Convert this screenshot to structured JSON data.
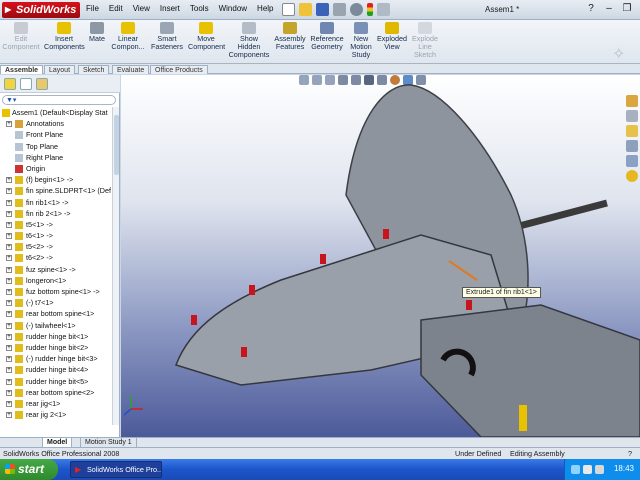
{
  "app": {
    "logo_text": "SolidWorks",
    "document_title": "Assem1 *",
    "menu": [
      "File",
      "Edit",
      "View",
      "Insert",
      "Tools",
      "Window",
      "Help"
    ]
  },
  "ribbon": {
    "buttons": [
      {
        "label_line1": "Edit",
        "label_line2": "Component",
        "enabled": false,
        "icon": "edit-component-icon"
      },
      {
        "label_line1": "Insert",
        "label_line2": "Components",
        "enabled": true,
        "icon": "insert-components-icon"
      },
      {
        "label_line1": "Mate",
        "label_line2": "",
        "enabled": true,
        "icon": "mate-icon"
      },
      {
        "label_line1": "Linear",
        "label_line2": "Compon...",
        "enabled": true,
        "icon": "linear-pattern-icon"
      },
      {
        "label_line1": "Smart",
        "label_line2": "Fasteners",
        "enabled": true,
        "icon": "smart-fasteners-icon"
      },
      {
        "label_line1": "Move",
        "label_line2": "Component",
        "enabled": true,
        "icon": "move-component-icon"
      },
      {
        "label_line1": "Show",
        "label_line2": "Hidden",
        "label_line3": "Components",
        "enabled": true,
        "icon": "show-hidden-icon"
      },
      {
        "label_line1": "Assembly",
        "label_line2": "Features",
        "enabled": true,
        "icon": "assembly-features-icon"
      },
      {
        "label_line1": "Reference",
        "label_line2": "Geometry",
        "enabled": true,
        "icon": "reference-geometry-icon"
      },
      {
        "label_line1": "New",
        "label_line2": "Motion",
        "label_line3": "Study",
        "enabled": true,
        "icon": "motion-study-icon"
      },
      {
        "label_line1": "Exploded",
        "label_line2": "View",
        "enabled": true,
        "icon": "exploded-view-icon"
      },
      {
        "label_line1": "Explode",
        "label_line2": "Line",
        "label_line3": "Sketch",
        "enabled": false,
        "icon": "explode-line-icon"
      }
    ]
  },
  "command_tabs": [
    "Assemble",
    "Layout",
    "Sketch",
    "Evaluate",
    "Office Products"
  ],
  "feature_tree": {
    "root": "Assem1  (Default<Display Stat",
    "items": [
      {
        "label": "Annotations",
        "icon": "annotations-icon",
        "expandable": true
      },
      {
        "label": "Front Plane",
        "icon": "plane-icon",
        "expandable": false
      },
      {
        "label": "Top Plane",
        "icon": "plane-icon",
        "expandable": false
      },
      {
        "label": "Right Plane",
        "icon": "plane-icon",
        "expandable": false
      },
      {
        "label": "Origin",
        "icon": "origin-icon",
        "expandable": false
      },
      {
        "label": "(f) begin<1> ->",
        "icon": "part-icon",
        "expandable": true
      },
      {
        "label": "fin spine.SLDPRT<1> (Def",
        "icon": "part-icon",
        "expandable": true
      },
      {
        "label": "fin rib1<1> ->",
        "icon": "part-icon",
        "expandable": true
      },
      {
        "label": "fin rib 2<1> ->",
        "icon": "part-icon",
        "expandable": true
      },
      {
        "label": "t5<1> ->",
        "icon": "part-icon",
        "expandable": true
      },
      {
        "label": "t6<1> ->",
        "icon": "part-icon",
        "expandable": true
      },
      {
        "label": "t5<2> ->",
        "icon": "part-icon",
        "expandable": true
      },
      {
        "label": "t6<2> ->",
        "icon": "part-icon",
        "expandable": true
      },
      {
        "label": "fuz spine<1> ->",
        "icon": "part-icon",
        "expandable": true
      },
      {
        "label": "longeron<1>",
        "icon": "part-icon",
        "expandable": true
      },
      {
        "label": "fuz bottom spine<1> ->",
        "icon": "part-icon",
        "expandable": true
      },
      {
        "label": "(-) t7<1>",
        "icon": "part-icon",
        "expandable": true
      },
      {
        "label": "rear bottom spine<1>",
        "icon": "part-icon",
        "expandable": true
      },
      {
        "label": "(-) tailwheel<1>",
        "icon": "part-icon",
        "expandable": true
      },
      {
        "label": "rudder hinge bit<1>",
        "icon": "part-icon",
        "expandable": true
      },
      {
        "label": "rudder hinge bit<2>",
        "icon": "part-icon",
        "expandable": true
      },
      {
        "label": "(-) rudder hinge bit<3>",
        "icon": "part-icon",
        "expandable": true
      },
      {
        "label": "rudder hinge bit<4>",
        "icon": "part-icon",
        "expandable": true
      },
      {
        "label": "rudder hinge bit<5>",
        "icon": "part-icon",
        "expandable": true
      },
      {
        "label": "rear bottom spine<2>",
        "icon": "part-icon",
        "expandable": true
      },
      {
        "label": "rear jig<1>",
        "icon": "part-icon",
        "expandable": true
      },
      {
        "label": "rear jig 2<1>",
        "icon": "part-icon",
        "expandable": true
      }
    ]
  },
  "bottom_tabs": [
    "Model",
    "Motion Study 1"
  ],
  "viewport": {
    "tooltip": "Extrude1 of fin rib1<1>"
  },
  "status": {
    "product": "SolidWorks Office Professional 2008",
    "definition": "Under Defined",
    "mode": "Editing Assembly",
    "help": "?"
  },
  "taskbar": {
    "start_label": "start",
    "task_label": "SolidWorks Office Pro...",
    "clock": "18:43"
  },
  "colors": {
    "accent_red": "#c8141c",
    "part_yellow": "#e8c200",
    "model_gray": "#8e949e",
    "taskbar_blue": "#245edb"
  }
}
